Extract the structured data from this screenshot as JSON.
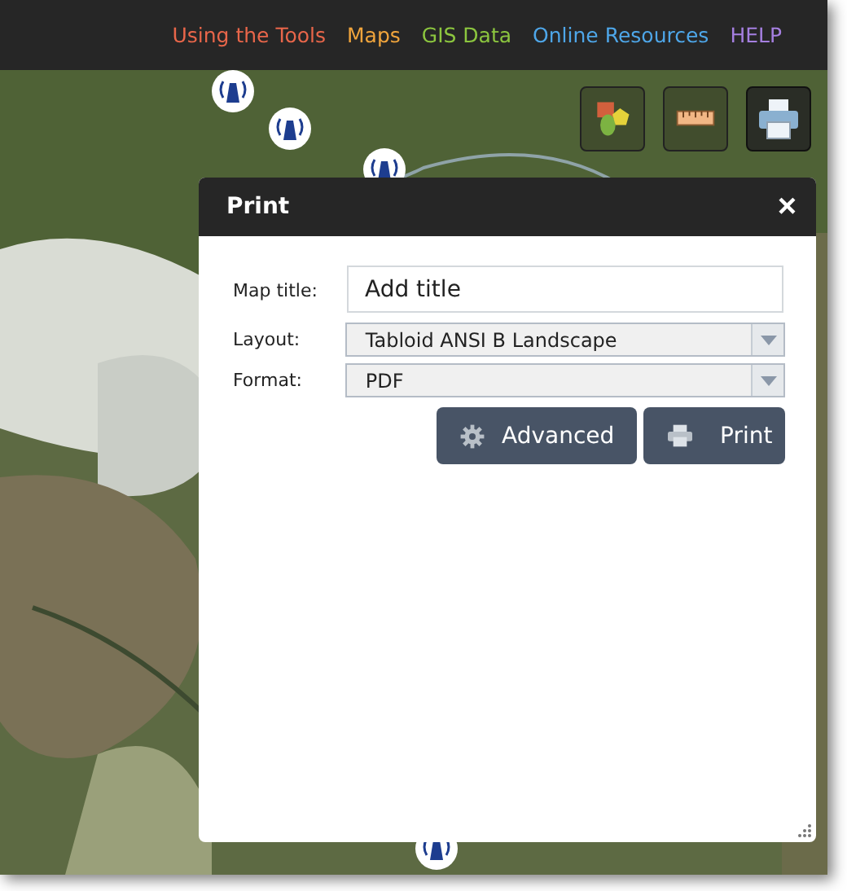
{
  "nav": [
    {
      "label": "Using the Tools",
      "color": "#e8664a"
    },
    {
      "label": "Maps",
      "color": "#f0a43c"
    },
    {
      "label": "GIS Data",
      "color": "#8cc63f"
    },
    {
      "label": "Online Resources",
      "color": "#4ea6e8"
    },
    {
      "label": "HELP",
      "color": "#a57fe0"
    }
  ],
  "tools": [
    {
      "kind": "shapes",
      "selected": false
    },
    {
      "kind": "ruler",
      "selected": false
    },
    {
      "kind": "printer",
      "selected": true
    }
  ],
  "dialog": {
    "title": "Print",
    "close": "×",
    "fields": [
      {
        "kind": "text",
        "label": "Map title:",
        "placeholder": "Add title"
      },
      {
        "kind": "select",
        "label": "Layout:",
        "value": "Tabloid ANSI B Landscape"
      },
      {
        "kind": "select",
        "label": "Format:",
        "value": "PDF"
      }
    ],
    "buttons": [
      {
        "kind": "gear",
        "label": "Advanced"
      },
      {
        "kind": "printer",
        "label": "Print"
      }
    ]
  }
}
